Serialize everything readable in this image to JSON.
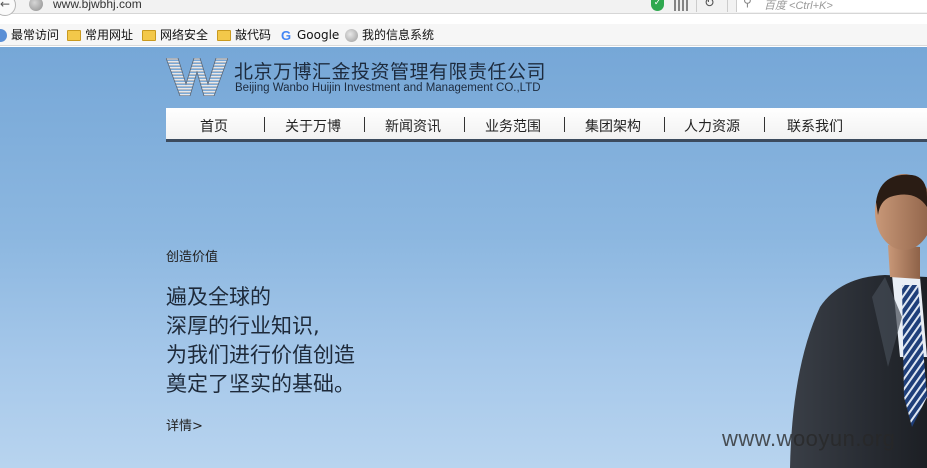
{
  "browser": {
    "url": "www.bjwbhj.com",
    "search_placeholder": "百度 <Ctrl+K>",
    "bookmarks": [
      {
        "label": "最常访问",
        "icon": "bookmark-icon"
      },
      {
        "label": "常用网址",
        "icon": "folder-icon"
      },
      {
        "label": "网络安全",
        "icon": "folder-icon"
      },
      {
        "label": "敲代码",
        "icon": "folder-icon"
      },
      {
        "label": "Google",
        "icon": "google-icon"
      },
      {
        "label": "我的信息系统",
        "icon": "globe-icon"
      }
    ]
  },
  "header": {
    "company_cn": "北京万博汇金投资管理有限责任公司",
    "company_en": "Beijing Wanbo Huijin Investment and Management CO.,LTD"
  },
  "nav": {
    "items": [
      "首页",
      "关于万博",
      "新闻资讯",
      "业务范围",
      "集团架构",
      "人力资源",
      "联系我们"
    ]
  },
  "hero": {
    "tag": "创造价值",
    "lines": [
      "遍及全球的",
      "深厚的行业知识,",
      "为我们进行价值创造",
      "奠定了坚实的基础。"
    ],
    "more_link": "详情>"
  },
  "watermark": "www.wooyun.org",
  "colors": {
    "sky_top": "#76a7d7",
    "sky_bottom": "#b8d4ef",
    "nav_border": "#3c4b5e"
  }
}
